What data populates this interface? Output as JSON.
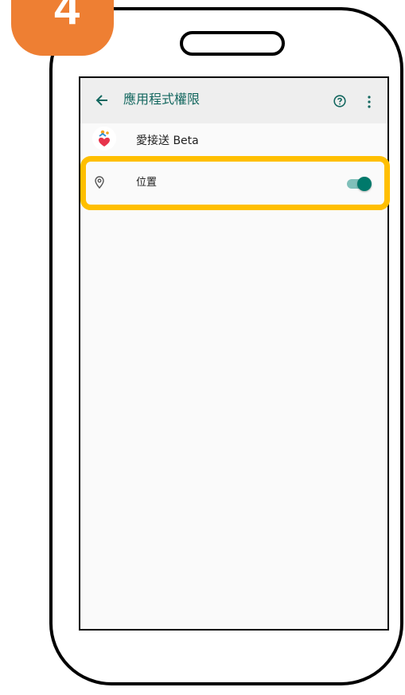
{
  "step_badge": {
    "number": "4"
  },
  "appbar": {
    "back_icon": "arrow-left-icon",
    "title": "應用程式權限",
    "help_icon": "help-circle-icon",
    "more_icon": "more-vert-icon"
  },
  "app": {
    "icon": "app-icon",
    "name": "愛接送 Beta"
  },
  "permissions": [
    {
      "icon": "location-pin-icon",
      "label": "位置",
      "enabled": true
    }
  ],
  "colors": {
    "badge": "#ee7f33",
    "accent": "#00796b",
    "highlight": "#ffbf00",
    "title_text": "#13675f"
  }
}
